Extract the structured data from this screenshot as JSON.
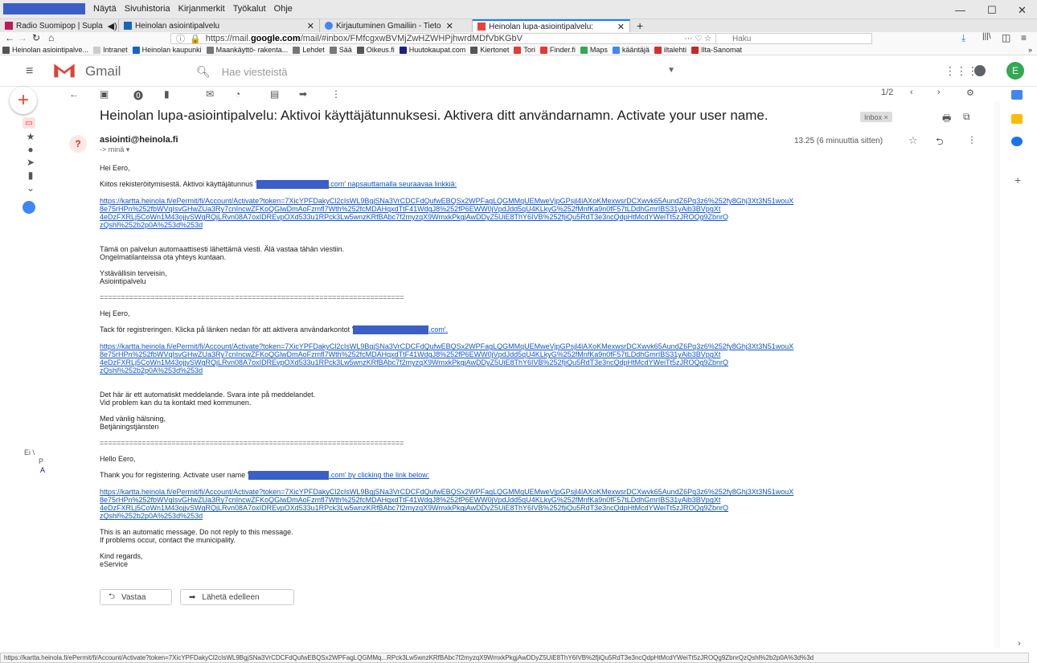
{
  "browser": {
    "menus": [
      "Näytä",
      "Sivuhistoria",
      "Kirjanmerkit",
      "Työkalut",
      "Ohje"
    ],
    "tabs": [
      {
        "label": "Radio Suomipop | Supla",
        "color": "#c2185b"
      },
      {
        "label": "Heinolan asiointipalvelu",
        "color": "#1565c0"
      },
      {
        "label": "Kirjautuminen Gmailiin - Tieto",
        "color": "#4285f4"
      },
      {
        "label": "Heinolan lupa-asiointipalvelu:",
        "color": "#ea4335"
      }
    ],
    "url_prefix": "https://mail.",
    "url_domain": "google.com",
    "url_suffix": "/mail/#inbox/FMfcgxwBVMjZwHZWHPjhwrdMDfVbKGbV",
    "search_placeholder": "Haku",
    "bookmarks": [
      {
        "label": "Heinolan asiointipalve...",
        "color": "#555555"
      },
      {
        "label": "Intranet",
        "color": "#cccccc"
      },
      {
        "label": "Heinolan kaupunki",
        "color": "#1565c0"
      },
      {
        "label": "Maankäyttö- rakenta...",
        "color": "#777777"
      },
      {
        "label": "Lehdet",
        "color": "#777777"
      },
      {
        "label": "Sää",
        "color": "#777777"
      },
      {
        "label": "Oikeus.fi",
        "color": "#555555"
      },
      {
        "label": "Huutokaupat.com",
        "color": "#1a237e"
      },
      {
        "label": "Kiertonet",
        "color": "#555555"
      },
      {
        "label": "Tori",
        "color": "#e53935"
      },
      {
        "label": "Finder.fi",
        "color": "#e53935"
      },
      {
        "label": "Maps",
        "color": "#34a853"
      },
      {
        "label": "kääntäjä",
        "color": "#4285f4"
      },
      {
        "label": "iltalehti",
        "color": "#d32f2f"
      },
      {
        "label": "Ilta-Sanomat",
        "color": "#c62828"
      }
    ]
  },
  "gmail": {
    "brand": "Gmail",
    "search_placeholder": "Hae viesteistä",
    "avatar_letter": "E",
    "pager": "1/2",
    "subject": "Heinolan lupa-asiointipalvelu: Aktivoi käyttäjätunnuksesi. Aktivera ditt användarnamn. Activate your user name.",
    "label_chip": "Inbox ×",
    "sender": "asiointi@heinola.fi",
    "to": "-> minä ▾",
    "time": "13.25 (6 minuuttia sitten)",
    "left_cut": [
      "Ei \\",
      "P",
      "A"
    ]
  },
  "message": {
    "fi": {
      "greeting": "Hei Eero,",
      "intro_pre": "Kiitos rekisteröitymisestä. Aktivoi käyttäjätunnus '",
      "intro_post": ".com' napsauttamalla seuraavaa linkkiä:",
      "auto": "Tämä on palvelun automaattisesti lähettämä viesti. Älä vastaa tähän viestiin.",
      "problems": "Ongelmatilanteissa ota yhteys kuntaan.",
      "regards": "Ystävällisin terveisin,",
      "service": "Asiointipalvelu"
    },
    "sv": {
      "greeting": "Hej Eero,",
      "intro_pre": "Tack för registreringen. Klicka på länken nedan för att aktivera användarkontot '",
      "intro_post": ".com'.",
      "auto": "Det här är ett automatiskt meddelande. Svara inte på meddelandet.",
      "problems": "Vid problem kan du ta kontakt med kommunen.",
      "regards": "Med vänlig hälsning,",
      "service": "Betjäningstjänsten"
    },
    "en": {
      "greeting": "Hello Eero,",
      "intro_pre": "Thank you for registering. Activate user name '",
      "intro_post": ".com' by clicking the link below:",
      "auto": "This is an automatic message. Do not reply to this message.",
      "problems": "If problems occur, contact the municipality.",
      "regards": "Kind regards,",
      "service": "eService"
    },
    "link_lines": [
      "https://kartta.heinola.fi/ePermit/fi/Account/Activate?token=7XicYPFDakyCl2cIsWL9BgjSNa3VrCDCFdQufwEBQSx2WPFagLQGMMqUEMweVjpGPsjl4lAXoKMexwsrDCXwvk65AundZ6Pq3z6%252fy8Ghj3Xt3N51wouX",
      "8e75rHPn%252fbWVqIsvGHwZUa3Ry7cnIncwZFKoQGlwDmAoFzmfl7Wth%252fcMDAHqxdTtF41WdgJ8%252fP6EWW0jVpdJdd5qU4KLkyG%252fMnfKa9n0fF57tLDdhGmrIBS31yAib3BVpgXt",
      "4eDzFXRLj5CoWn1M43ojjvSWgRQjLRvn08A7oxIDREvpOXd533u1RPck3Lw5wnzKRfBAbc7f2myzqX9WmxkPkgjAwDDyZ5UiE8ThY6IVB%252fjiQu5RdT3e3ncQdpHtMcdYWeiTt5zJROQg9ZbnrQ",
      "zQshl%252b2p0A%253d%253d"
    ],
    "separator": "========================================================================",
    "reply_label": "Vastaa",
    "forward_label": "Lähetä edelleen"
  },
  "status_url": "https://kartta.heinola.fi/ePermit/fi/Account/Activate?token=7XicYPFDakyCl2cIsWL9BgjSNa3VrCDCFdQufwEBQSx2WPFagLQGMMq...RPck3Lw5wnzKRfBAbc7f2myzqX9WmxkPkgjAwDDyZ5UiE8ThY6IVB%2fjiQu5RdT3e3ncQdpHtMcdYWeiTt5zJROQg9ZbnrQzQshl%2b2p0A%3d%3d"
}
